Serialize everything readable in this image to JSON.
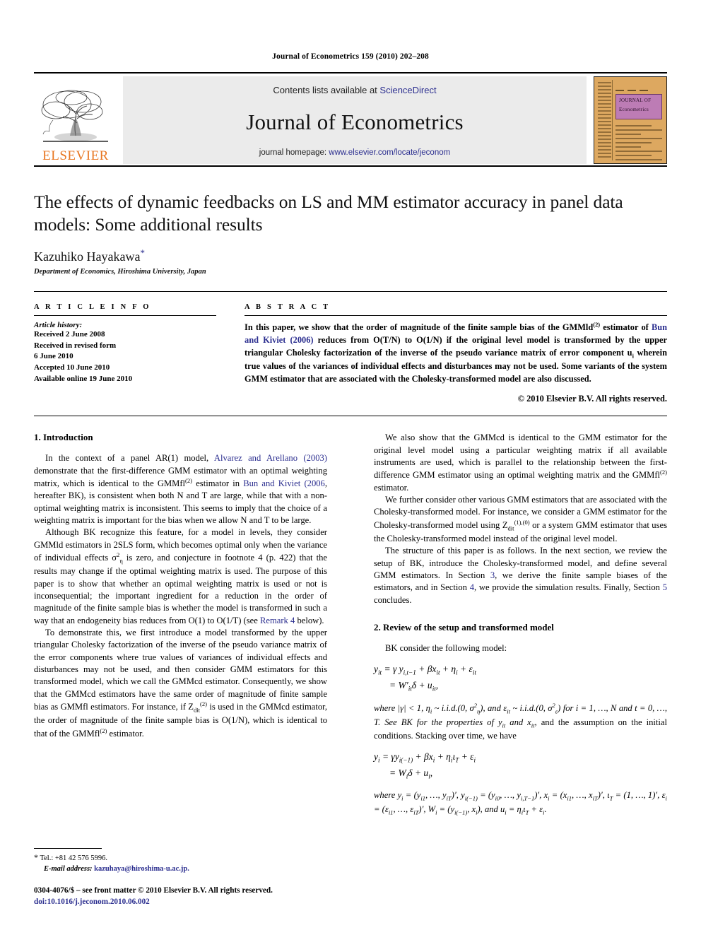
{
  "running_head": "Journal of Econometrics 159 (2010) 202–208",
  "masthead": {
    "publisher_name": "ELSEVIER",
    "contents_prefix": "Contents lists available at ",
    "contents_link": "ScienceDirect",
    "journal_title": "Journal of Econometrics",
    "homepage_prefix": "journal homepage: ",
    "homepage_link": "www.elsevier.com/locate/jeconom",
    "cover_title_line1": "JOURNAL OF",
    "cover_title_line2": "Econometrics",
    "accent_orange": "#e87722",
    "link_blue": "#2b2e8f",
    "cover_orange": "#dda860",
    "cover_purple": "#bd7cb5",
    "panel_grey": "#ebebeb"
  },
  "article": {
    "title": "The effects of dynamic feedbacks on LS and MM estimator accuracy in panel data models: Some additional results",
    "author": "Kazuhiko Hayakawa",
    "author_footnote_marker": "*",
    "affiliation": "Department of Economics, Hiroshima University, Japan"
  },
  "info": {
    "heading": "A R T I C L E    I N F O",
    "history_label": "Article history:",
    "history": [
      "Received 2 June 2008",
      "Received in revised form",
      "6 June 2010",
      "Accepted 10 June 2010",
      "Available online 19 June 2010"
    ]
  },
  "abstract": {
    "heading": "A B S T R A C T",
    "text_part1": "In this paper, we show that the order of magnitude of the finite sample bias of the GMMld",
    "sup1": "(2)",
    "text_part2": " estimator of ",
    "citation": "Bun and Kiviet (2006)",
    "text_part3": " reduces from O(T/N) to O(1/N) if the original level model is transformed by the upper triangular Cholesky factorization of the inverse of the pseudo variance matrix of error component u",
    "sub1": "i",
    "text_part4": " wherein true values of the variances of individual effects and disturbances may not be used. Some variants of the system GMM estimator that are associated with the Cholesky-transformed model are also discussed.",
    "copyright": "© 2010 Elsevier B.V. All rights reserved."
  },
  "sections": {
    "intro_heading": "1. Introduction",
    "intro_p1_a": "In the context of a panel AR(1) model, ",
    "intro_p1_cite1": "Alvarez and Arellano (2003)",
    "intro_p1_b": " demonstrate that the first-difference GMM estimator with an optimal weighting matrix, which is identical to the GMMfl",
    "intro_p1_sup": "(2)",
    "intro_p1_c": " estimator in ",
    "intro_p1_cite2": "Bun and Kiviet (2006",
    "intro_p1_d": ", hereafter BK), is consistent when both N and T are large, while that with a non-optimal weighting matrix is inconsistent. This seems to imply that the choice of a weighting matrix is important for the bias when we allow N and T to be large.",
    "intro_p2_a": "Although BK recognize this feature, for a model in levels, they consider GMMld estimators in 2SLS form, which becomes optimal only when the variance of individual effects σ",
    "intro_p2_b": " is zero, and conjecture in footnote 4 (p. 422) that the results may change if the optimal weighting matrix is used. The purpose of this paper is to show that whether an optimal weighting matrix is used or not is inconsequential; the important ingredient for a reduction in the order of magnitude of the finite sample bias is whether the model is transformed in such a way that an endogeneity bias reduces from O(1) to O(1/T) (see ",
    "intro_p2_remark": "Remark 4",
    "intro_p2_c": " below).",
    "intro_p3_a": "To demonstrate this, we first introduce a model transformed by the upper triangular Cholesky factorization of the inverse of the pseudo variance matrix of the error components where true values of variances of individual effects and disturbances may not be used, and then consider GMM estimators for this transformed model, which we call the GMMcd estimator. Consequently, we show that the GMMcd estimators have the same order of magnitude of finite sample bias as GMMfl estimators. For instance, if Z",
    "intro_p3_b": " is used in the GMMcd estimator, the order of magnitude of the finite sample bias is O(1/N), which is identical to that of the GMMfl",
    "intro_p3_sup": "(2)",
    "intro_p3_c": " estimator.",
    "right_p1_a": "We also show that the GMMcd is identical to the GMM estimator for the original level model using a particular weighting matrix if all available instruments are used, which is parallel to the relationship between the first-difference GMM estimator using an optimal weighting matrix and the GMMfl",
    "right_p1_sup": "(2)",
    "right_p1_b": " estimator.",
    "right_p2_a": "We further consider other various GMM estimators that are associated with the Cholesky-transformed model. For instance, we consider a GMM estimator for the Cholesky-transformed model using Z",
    "right_p2_b": " or a system GMM estimator that uses the Cholesky-transformed model instead of the original level model.",
    "right_p3_a": "The structure of this paper is as follows. In the next section, we review the setup of BK, introduce the Cholesky-transformed model, and define several GMM estimators. In Section ",
    "right_p3_s3": "3",
    "right_p3_b": ", we derive the finite sample biases of the estimators, and in Section ",
    "right_p3_s4": "4",
    "right_p3_c": ", we provide the simulation results. Finally, Section ",
    "right_p3_s5": "5",
    "right_p3_d": " concludes.",
    "sec2_heading": "2. Review of the setup and transformed model",
    "sec2_lead": "BK consider the following model:",
    "sec2_mid": "and the assumption on the initial conditions. Stacking over time, we have"
  },
  "equations": {
    "eq1_line1": "y_it = γ y_{i,t−1} + βx_it + η_i + ε_it",
    "eq1_line2": "= W′_it δ + u_it,",
    "eq1_where": "where |γ| < 1, η_i ~ i.i.d.(0, σ²_η), and ε_it ~ i.i.d.(0, σ²_ε) for i = 1, …, N and t = 0, …, T. See BK for the properties of y_it and x_it,",
    "eq2_line1": "y_i = γ y_{i(−1)} + βx_i + η_i ι_T + ε_i",
    "eq2_line2": "= W_i δ + u_i,",
    "eq2_where": "where y_i = (y_i1, …, y_iT)′, y_{i(−1)} = (y_i0, …, y_{i,T−1})′, x_i = (x_i1, …, x_iT)′, ι_T = (1, …, 1)′, ε_i = (ε_i1, …, ε_iT)′, W_i = (y_{i(−1)}, x_i), and u_i = η_i ι_T + ε_i."
  },
  "footnotes": {
    "star": "*",
    "tel": "Tel.: +81 42 576 5996.",
    "email_label": "E-mail address:",
    "email": "kazuhaya@hiroshima-u.ac.jp.",
    "issn_line": "0304-4076/$ – see front matter © 2010 Elsevier B.V. All rights reserved.",
    "doi": "doi:10.1016/j.jeconom.2010.06.002"
  }
}
